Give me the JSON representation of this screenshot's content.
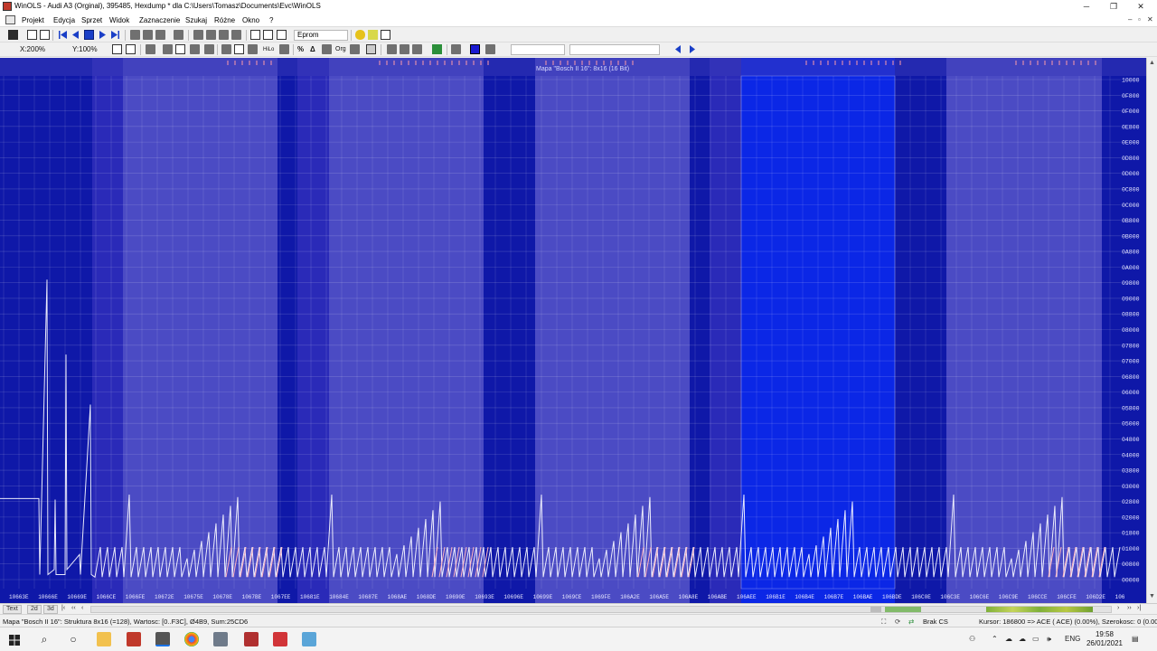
{
  "window": {
    "title": "WinOLS - Audi A3 (Orginal), 395485, Hexdump * dla C:\\Users\\Tomasz\\Documents\\Evc\\WinOLS",
    "minimize": "─",
    "restore": "❐",
    "close": "✕"
  },
  "menu": {
    "items": [
      "Projekt",
      "Edycja",
      "Sprzet",
      "Widok",
      "Zaznaczenie",
      "Szukaj",
      "Różne",
      "Okno",
      "?"
    ],
    "mdi_minimize": "–",
    "mdi_restore": "▫",
    "mdi_close": "✕"
  },
  "toolbar1": {
    "eprom_label": "Eprom"
  },
  "toolbar2": {
    "zoom_x": "X:200%",
    "zoom_y": "Y:100%",
    "hilo_label": "HiLo",
    "org_label": "Org"
  },
  "graph": {
    "map_label": "Mapa \"Bosch II 16\": 8x16 (16 Bit)",
    "y_ticks": [
      "10000",
      "0F800",
      "0F000",
      "0E800",
      "0E000",
      "0D800",
      "0D000",
      "0C800",
      "0C000",
      "0B800",
      "0B000",
      "0A800",
      "0A000",
      "09800",
      "09000",
      "08800",
      "08000",
      "07800",
      "07000",
      "06800",
      "06000",
      "05800",
      "05000",
      "04800",
      "04000",
      "03800",
      "03000",
      "02800",
      "02000",
      "01800",
      "01000",
      "00800",
      "00000"
    ],
    "x_ticks": [
      "1066 3E",
      "1066 6E",
      "1066 9E",
      "1066 CE",
      "1066 FE",
      "1067 2E",
      "1067 5E",
      "1067 8E",
      "1067 BE",
      "1067 EE",
      "1068 1E",
      "1068 4E",
      "1068 7E",
      "1068 AE",
      "1068 DE",
      "1069 0E",
      "1069 3E",
      "1069 6E",
      "1069 9E",
      "1069 CE",
      "1069 FE",
      "106A 2E",
      "106A 5E",
      "106A 8E",
      "106A BE",
      "106A EE",
      "106B 1E",
      "106B 4E",
      "106B 7E",
      "106B AE",
      "106B DE",
      "106C 0E",
      "106C 3E",
      "106C 6E",
      "106C 9E",
      "106C CE",
      "106C FE",
      "106D 2E",
      "106"
    ]
  },
  "tabs": [
    "Text",
    "2d",
    "3d"
  ],
  "status": {
    "left": "Mapa \"Bosch II 16\": Struktura 8x16 (=128), Wartosc: [0..F3C], Ø4B9, Sum:25CD6",
    "cs": "Brak CS",
    "cursor": "Kursor: 186800 => ACE ( ACE) (0.00%), Szerokosc: 0 (0.00%)",
    "extra": "Szerokosc: 0"
  },
  "taskbar": {
    "lang": "ENG",
    "time": "19:58",
    "date": "26/01/2021"
  },
  "colors": {
    "graph_bg": "#4b4bc4",
    "graph_dark": "#0f18a8",
    "graph_mid": "#2a2ab8",
    "graph_bright": "#0b27e6"
  }
}
